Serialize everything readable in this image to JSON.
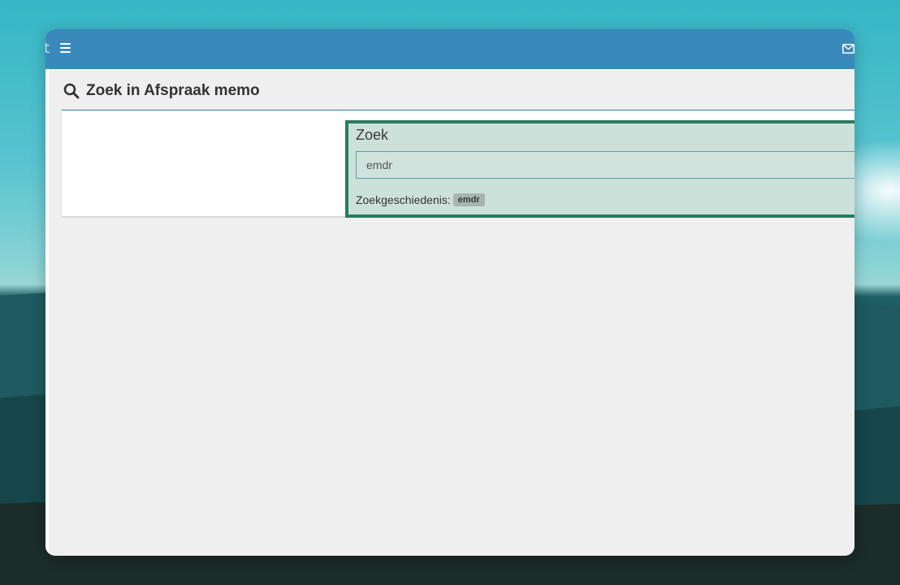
{
  "topbar": {
    "cut_text": "t",
    "menu_icon": "hamburger-menu-icon",
    "mail_icon": "envelope-icon",
    "color": "#3989bb"
  },
  "page": {
    "title": "Zoek in Afspraak memo",
    "title_icon": "search-icon"
  },
  "search": {
    "label": "Zoek",
    "query": "emdr",
    "history_label": "Zoekgeschiedenis:",
    "history": [
      "emdr"
    ],
    "highlight_color": "#2b7b5f"
  }
}
